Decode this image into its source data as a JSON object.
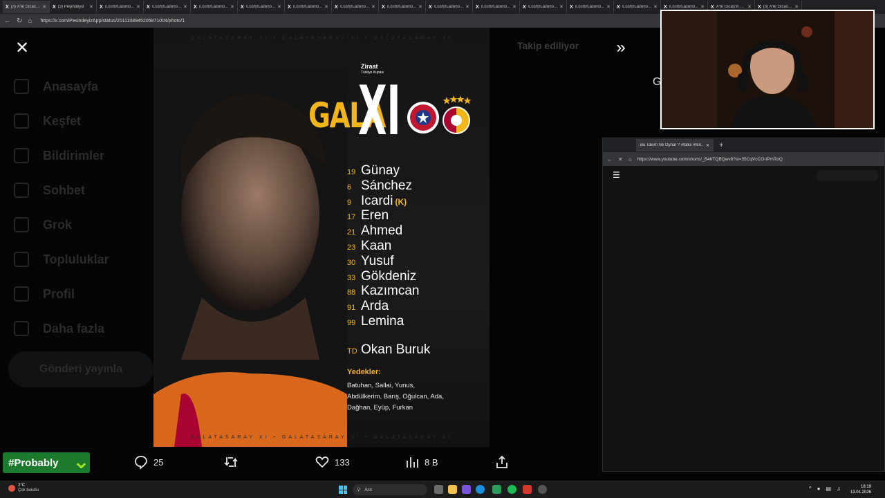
{
  "browser": {
    "tabs": [
      {
        "label": "(3) X'te Gicas…"
      },
      {
        "label": "(3) Peşindeyiz"
      },
      {
        "label": "x.com/Lazerio…"
      },
      {
        "label": "x.com/Lazerio…"
      },
      {
        "label": "x.com/Lazerio…"
      },
      {
        "label": "x.com/Lazerio…"
      },
      {
        "label": "x.com/Lazerio…"
      },
      {
        "label": "x.com/Lazerio…"
      },
      {
        "label": "x.com/Lazerio…"
      },
      {
        "label": "x.com/Lazerio…"
      },
      {
        "label": "x.com/Lazerio…"
      },
      {
        "label": "x.com/Lazerio…"
      },
      {
        "label": "x.com/Lazerio…"
      },
      {
        "label": "x.com/Lazerio…"
      },
      {
        "label": "x.com/Lazerio…"
      },
      {
        "label": "X'te Gicas'in …"
      },
      {
        "label": "(3) X'te Gicas…"
      }
    ],
    "url": "https://x.com/PesindeyizApp/status/2011108945205871004/photo/1"
  },
  "x_background": {
    "nav": [
      "Anasayfa",
      "Keşfet",
      "Bildirimler",
      "Sohbet",
      "Grok",
      "Topluluklar",
      "Profil",
      "Daha fazla"
    ],
    "post_button": "Gönderi yayınla",
    "follow_label": "Takip ediliyor",
    "side_letter": "G"
  },
  "poster": {
    "header": "GALATASARAY XI  •  GALATASARAY XI  •  GALATASARAY XI",
    "footer": "GALATASARAY XI  •  GALATASARAY XI  •  GALATASARAY XI",
    "cup_name": "Ziraat",
    "cup_sub": "Türkiye Kupası",
    "title_left": "GALA",
    "title_right": "XI",
    "lineup": [
      {
        "num": "19",
        "name": "Günay"
      },
      {
        "num": "6",
        "name": "Sánchez"
      },
      {
        "num": "9",
        "name": "Icardi",
        "captain": "(K)"
      },
      {
        "num": "17",
        "name": "Eren"
      },
      {
        "num": "21",
        "name": "Ahmed"
      },
      {
        "num": "23",
        "name": "Kaan"
      },
      {
        "num": "30",
        "name": "Yusuf"
      },
      {
        "num": "33",
        "name": "Gökdeniz"
      },
      {
        "num": "88",
        "name": "Kazımcan"
      },
      {
        "num": "91",
        "name": "Arda"
      },
      {
        "num": "99",
        "name": "Lemina"
      }
    ],
    "coach": {
      "num": "TD",
      "name": "Okan Buruk"
    },
    "subs_title": "Yedekler:",
    "subs": "Batuhan, Sallai, Yunus, Abdülkerim, Barış, Oğulcan, Ada, Dağhan, Eyüp, Furkan"
  },
  "actions": {
    "replies": "25",
    "likes": "133",
    "views": "8 B"
  },
  "watermark": "#Probably",
  "second_window": {
    "tab_label": "Bu Takım Ne Oynar ? #talks #fen…",
    "url": "https://www.youtube.com/shorts/_B4hTQBQwv8?si=35CqVcCO-tPmTciQ"
  },
  "taskbar": {
    "temp": "2°C",
    "weather": "Çok bulutlu",
    "search": "Ara",
    "time": "18:19",
    "date": "13.01.2026"
  },
  "colors": {
    "accent_gold": "#f2b51a",
    "galatasaray_red": "#a90432",
    "x_bg": "#050505"
  }
}
